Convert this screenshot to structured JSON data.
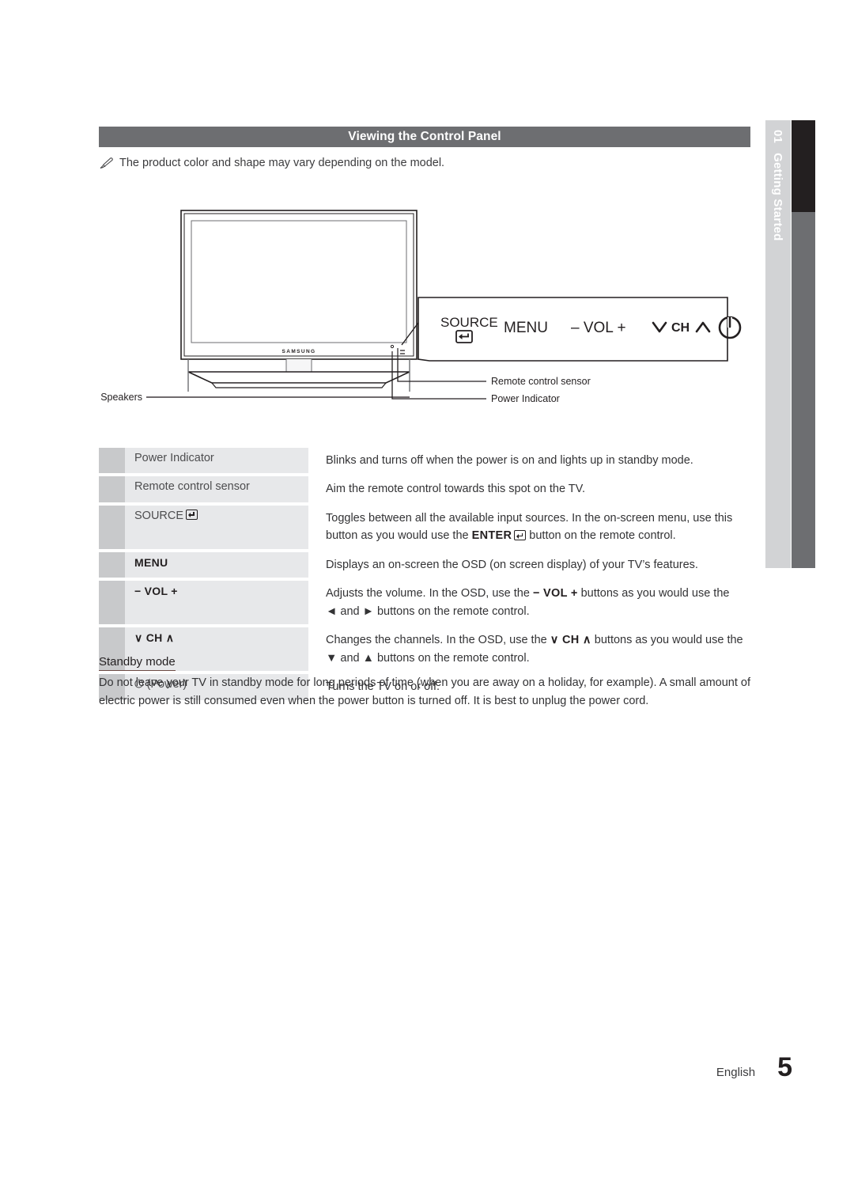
{
  "side_tab": {
    "chapter_number": "01",
    "chapter_title": "Getting Started",
    "strip_light_color": "#d2d3d5",
    "strip_dark_color": "#231f20",
    "strip_gray_color": "#6d6e71"
  },
  "header": {
    "title": "Viewing the Control Panel",
    "bg_color": "#6d6e71",
    "text_color": "#ffffff"
  },
  "note": {
    "icon": "pencil-note-icon",
    "text": "The product color and shape may vary depending on the model."
  },
  "illustration": {
    "tv_brand": "SAMSUNG",
    "callouts": [
      {
        "label": "Speakers",
        "target": "tv-speakers"
      },
      {
        "label": "Remote control sensor",
        "target": "remote-sensor"
      },
      {
        "label": "Power Indicator",
        "target": "power-indicator"
      }
    ],
    "control_panel_buttons": [
      {
        "label": "SOURCE",
        "icon": "enter-icon"
      },
      {
        "label": "MENU",
        "icon": ""
      },
      {
        "label": "− VOL +",
        "icon": ""
      },
      {
        "label": "CH",
        "icon": "chevron-down-up-icon"
      },
      {
        "label": "",
        "icon": "power-icon"
      }
    ]
  },
  "table": {
    "rows": [
      {
        "label": "Power Indicator",
        "label_style": "normal",
        "label_icon": "",
        "desc_lines": [
          [
            {
              "t": "Blinks and turns off when the power is on and lights up in standby mode."
            }
          ]
        ]
      },
      {
        "label": "Remote control sensor",
        "label_style": "normal",
        "label_icon": "",
        "desc_lines": [
          [
            {
              "t": "Aim the remote control towards this spot on the TV."
            }
          ]
        ]
      },
      {
        "label": "SOURCE",
        "label_style": "normal",
        "label_icon": "enter-icon",
        "desc_lines": [
          [
            {
              "t": "Toggles between all the available input sources. In the on-screen menu, use this"
            }
          ],
          [
            {
              "t": "button as you would use the "
            },
            {
              "t": "ENTER",
              "b": true
            },
            {
              "icon": "enter-icon"
            },
            {
              "t": " button on the remote control."
            }
          ]
        ]
      },
      {
        "label": "MENU",
        "label_style": "bold",
        "label_icon": "",
        "desc_lines": [
          [
            {
              "t": "Displays an on-screen the OSD (on screen display) of your TV’s features."
            }
          ]
        ]
      },
      {
        "label": "− VOL +",
        "label_style": "bold",
        "label_icon": "",
        "desc_lines": [
          [
            {
              "t": "Adjusts the volume. In the OSD, use the "
            },
            {
              "t": "− VOL +",
              "b": true
            },
            {
              "t": " buttons as you would use the"
            }
          ],
          [
            {
              "t": "◄ and ► buttons on the remote control."
            }
          ]
        ]
      },
      {
        "label": "∨ CH ∧",
        "label_style": "bold",
        "label_icon": "",
        "desc_lines": [
          [
            {
              "t": "Changes the channels. In the OSD, use the "
            },
            {
              "t": "∨ CH ∧",
              "b": true
            },
            {
              "t": " buttons as you would use the"
            }
          ],
          [
            {
              "t": "▼ and ▲ buttons on the remote control."
            }
          ]
        ]
      },
      {
        "label": "⏻ (Power)",
        "label_style": "normal",
        "label_icon": "",
        "desc_lines": [
          [
            {
              "t": "Turns the TV on or off."
            }
          ]
        ]
      }
    ]
  },
  "standby": {
    "title": "Standby mode",
    "body": "Do not leave your TV in standby mode for long periods of time (when you are away on a holiday, for example). A small amount of electric power is still consumed even when the power button is turned off. It is best to unplug the power cord."
  },
  "footer": {
    "language": "English",
    "page_number": "5"
  }
}
